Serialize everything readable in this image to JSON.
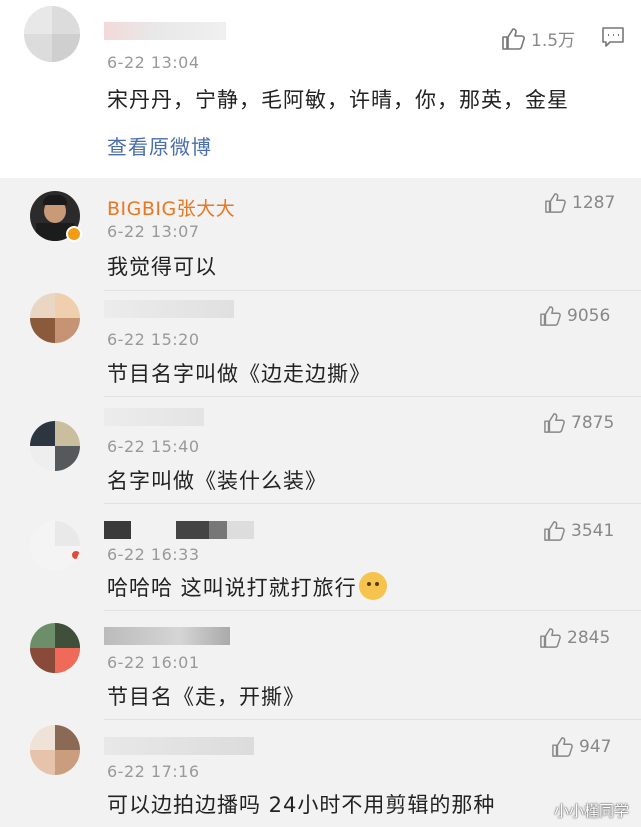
{
  "top_post": {
    "time": "6-22 13:04",
    "likes": "1.5万",
    "text": "宋丹丹，宁静，毛阿敏，许晴，你，那英，金星",
    "view_original": "查看原微博"
  },
  "comments": [
    {
      "name": "BIGBIG张大大",
      "time": "6-22 13:07",
      "text": "我觉得可以",
      "likes": "1287"
    },
    {
      "time": "6-22 15:20",
      "text": "节目名字叫做《边走边撕》",
      "likes": "9056"
    },
    {
      "time": "6-22 15:40",
      "text": "名字叫做《装什么装》",
      "likes": "7875"
    },
    {
      "time": "6-22 16:33",
      "text": "哈哈哈  这叫说打就打旅行",
      "likes": "3541"
    },
    {
      "time": "6-22 16:01",
      "text": "节目名《走，开撕》",
      "likes": "2845"
    },
    {
      "time": "6-22 17:16",
      "text": "可以边拍边播吗 24小时不用剪辑的那种",
      "likes": "947"
    }
  ],
  "watermark": "小小槿同学",
  "icons": {
    "like": "thumbs-up-icon",
    "comment": "comment-icon",
    "emoji": "dog-face-emoji"
  }
}
